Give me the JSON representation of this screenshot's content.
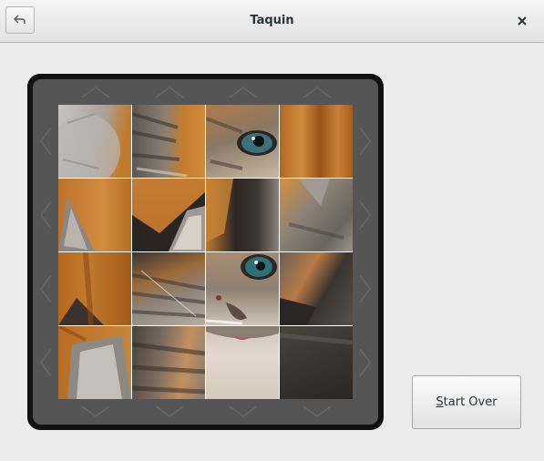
{
  "window": {
    "title": "Taquin",
    "back_icon": "back-arrow-icon",
    "close_icon": "close-icon"
  },
  "board": {
    "rows": 4,
    "cols": 4,
    "arrow_color": "#5f5f5f",
    "tiles": [
      {
        "desc": "grey cat fur on orange background"
      },
      {
        "desc": "striped fur with orange background"
      },
      {
        "desc": "cat eye with tabby fur"
      },
      {
        "desc": "orange wooden background"
      },
      {
        "desc": "grey cat ear on orange"
      },
      {
        "desc": "dark ear over orange background"
      },
      {
        "desc": "dark fur edge on orange"
      },
      {
        "desc": "grey fur with orange"
      },
      {
        "desc": "orange background with dark fur"
      },
      {
        "desc": "striped calico fur with whiskers"
      },
      {
        "desc": "cat eye and nose"
      },
      {
        "desc": "calico fur patches"
      },
      {
        "desc": "cat ear on orange"
      },
      {
        "desc": "tabby fur stripes"
      },
      {
        "desc": "cat mouth and white chin"
      },
      {
        "desc": "dark grey fur"
      }
    ]
  },
  "start_over": {
    "label_mnemonic": "S",
    "label_rest": "tart Over"
  }
}
